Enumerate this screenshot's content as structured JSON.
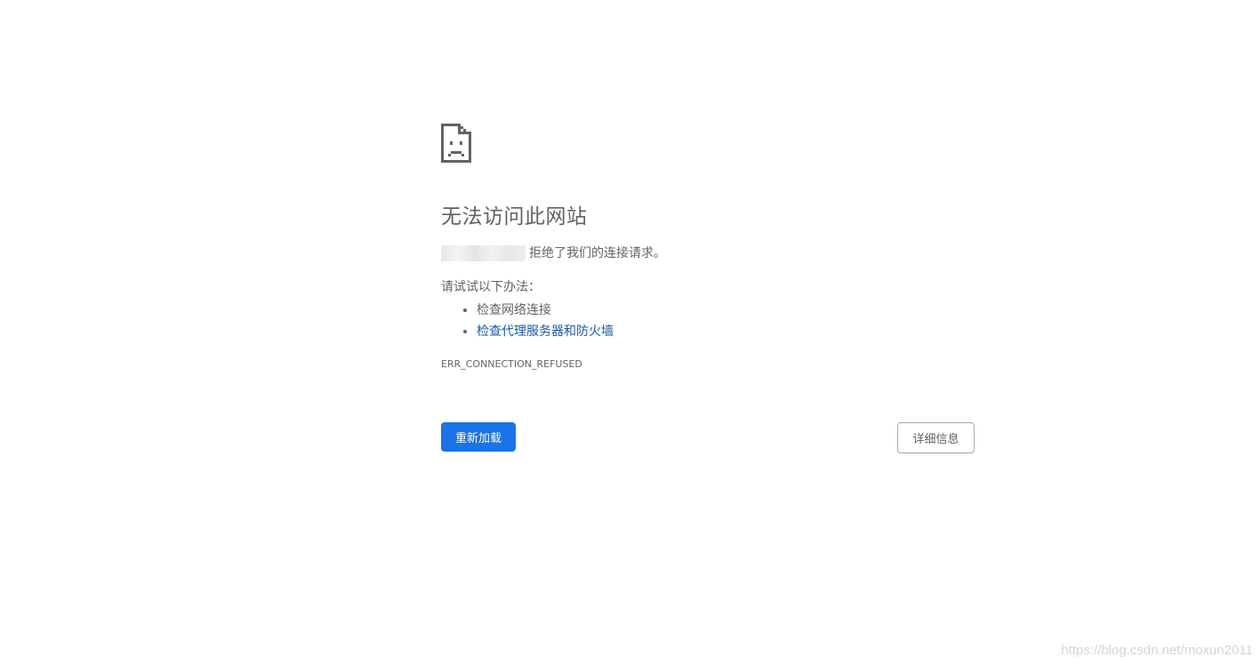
{
  "error_page": {
    "title": "无法访问此网站",
    "message_suffix": "拒绝了我们的连接请求。",
    "suggestions_header": "请试试以下办法：",
    "suggestions": [
      {
        "label": "检查网络连接",
        "is_link": false
      },
      {
        "label": "检查代理服务器和防火墙",
        "is_link": true
      }
    ],
    "error_code": "ERR_CONNECTION_REFUSED",
    "reload_label": "重新加载",
    "details_label": "详细信息"
  },
  "watermark": "https://blog.csdn.net/moxun2011",
  "colors": {
    "primary_button": "#1a73e8",
    "link": "#1a56a8",
    "text": "#5f6368",
    "background": "#ffffff"
  },
  "icons": {
    "error": "sad-page-icon"
  }
}
